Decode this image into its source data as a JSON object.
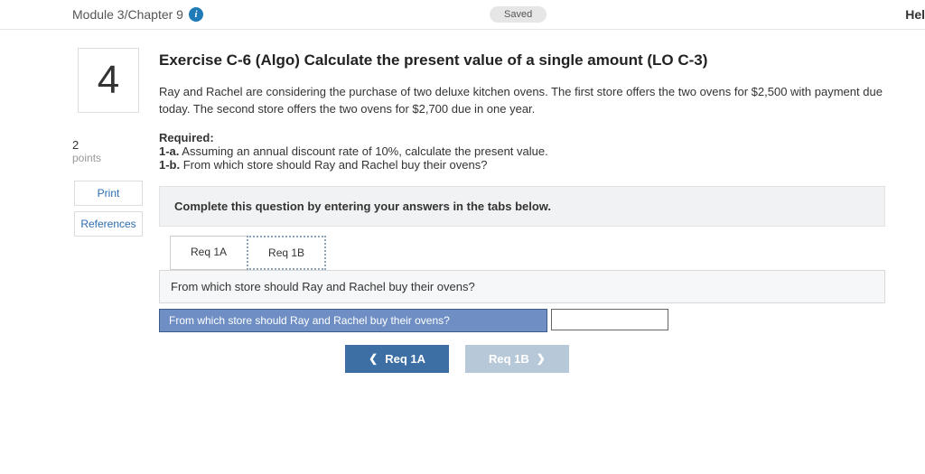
{
  "header": {
    "breadcrumb": "Module 3/Chapter 9",
    "saved": "Saved",
    "help": "Hel"
  },
  "sidebar": {
    "question_number": "4",
    "points_value": "2",
    "points_label": "points",
    "print": "Print",
    "references": "References"
  },
  "exercise": {
    "title": "Exercise C-6 (Algo) Calculate the present value of a single amount (LO C-3)",
    "prompt": "Ray and Rachel are considering the purchase of two deluxe kitchen ovens. The first store offers the two ovens for $2,500 with payment due today. The second store offers the two ovens for $2,700 due in one year.",
    "required_label": "Required:",
    "req_1a_tag": "1-a.",
    "req_1a_text": " Assuming an annual discount rate of 10%, calculate the present value.",
    "req_1b_tag": "1-b.",
    "req_1b_text": " From which store should Ray and Rachel buy their ovens?",
    "instruction": "Complete this question by entering your answers in the tabs below.",
    "tabs": {
      "a": "Req 1A",
      "b": "Req 1B"
    },
    "tab_question": "From which store should Ray and Rachel buy their ovens?",
    "answer_label": "From which store should Ray and Rachel buy their ovens?",
    "answer_value": "",
    "nav": {
      "prev": "Req 1A",
      "next": "Req 1B"
    }
  }
}
